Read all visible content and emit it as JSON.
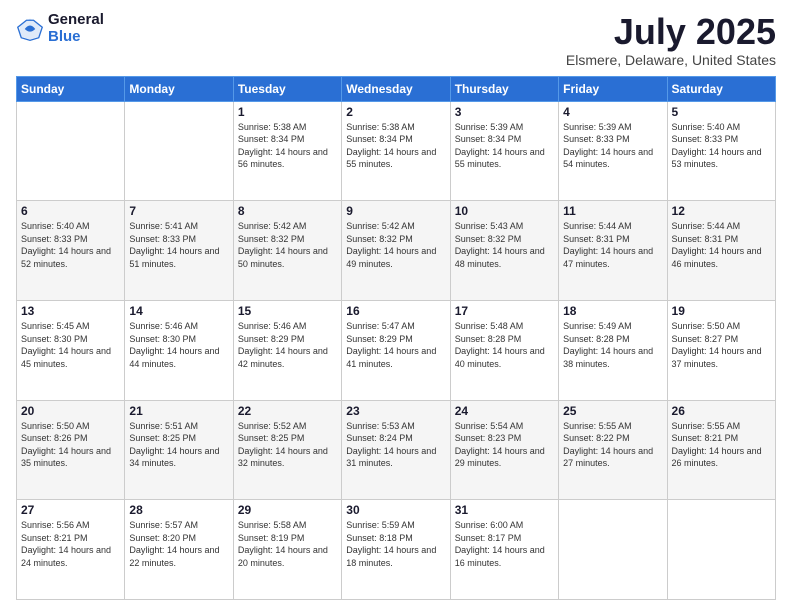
{
  "logo": {
    "general": "General",
    "blue": "Blue"
  },
  "title": "July 2025",
  "subtitle": "Elsmere, Delaware, United States",
  "days_of_week": [
    "Sunday",
    "Monday",
    "Tuesday",
    "Wednesday",
    "Thursday",
    "Friday",
    "Saturday"
  ],
  "weeks": [
    [
      {
        "day": "",
        "sunrise": "",
        "sunset": "",
        "daylight": ""
      },
      {
        "day": "",
        "sunrise": "",
        "sunset": "",
        "daylight": ""
      },
      {
        "day": "1",
        "sunrise": "Sunrise: 5:38 AM",
        "sunset": "Sunset: 8:34 PM",
        "daylight": "Daylight: 14 hours and 56 minutes."
      },
      {
        "day": "2",
        "sunrise": "Sunrise: 5:38 AM",
        "sunset": "Sunset: 8:34 PM",
        "daylight": "Daylight: 14 hours and 55 minutes."
      },
      {
        "day": "3",
        "sunrise": "Sunrise: 5:39 AM",
        "sunset": "Sunset: 8:34 PM",
        "daylight": "Daylight: 14 hours and 55 minutes."
      },
      {
        "day": "4",
        "sunrise": "Sunrise: 5:39 AM",
        "sunset": "Sunset: 8:33 PM",
        "daylight": "Daylight: 14 hours and 54 minutes."
      },
      {
        "day": "5",
        "sunrise": "Sunrise: 5:40 AM",
        "sunset": "Sunset: 8:33 PM",
        "daylight": "Daylight: 14 hours and 53 minutes."
      }
    ],
    [
      {
        "day": "6",
        "sunrise": "Sunrise: 5:40 AM",
        "sunset": "Sunset: 8:33 PM",
        "daylight": "Daylight: 14 hours and 52 minutes."
      },
      {
        "day": "7",
        "sunrise": "Sunrise: 5:41 AM",
        "sunset": "Sunset: 8:33 PM",
        "daylight": "Daylight: 14 hours and 51 minutes."
      },
      {
        "day": "8",
        "sunrise": "Sunrise: 5:42 AM",
        "sunset": "Sunset: 8:32 PM",
        "daylight": "Daylight: 14 hours and 50 minutes."
      },
      {
        "day": "9",
        "sunrise": "Sunrise: 5:42 AM",
        "sunset": "Sunset: 8:32 PM",
        "daylight": "Daylight: 14 hours and 49 minutes."
      },
      {
        "day": "10",
        "sunrise": "Sunrise: 5:43 AM",
        "sunset": "Sunset: 8:32 PM",
        "daylight": "Daylight: 14 hours and 48 minutes."
      },
      {
        "day": "11",
        "sunrise": "Sunrise: 5:44 AM",
        "sunset": "Sunset: 8:31 PM",
        "daylight": "Daylight: 14 hours and 47 minutes."
      },
      {
        "day": "12",
        "sunrise": "Sunrise: 5:44 AM",
        "sunset": "Sunset: 8:31 PM",
        "daylight": "Daylight: 14 hours and 46 minutes."
      }
    ],
    [
      {
        "day": "13",
        "sunrise": "Sunrise: 5:45 AM",
        "sunset": "Sunset: 8:30 PM",
        "daylight": "Daylight: 14 hours and 45 minutes."
      },
      {
        "day": "14",
        "sunrise": "Sunrise: 5:46 AM",
        "sunset": "Sunset: 8:30 PM",
        "daylight": "Daylight: 14 hours and 44 minutes."
      },
      {
        "day": "15",
        "sunrise": "Sunrise: 5:46 AM",
        "sunset": "Sunset: 8:29 PM",
        "daylight": "Daylight: 14 hours and 42 minutes."
      },
      {
        "day": "16",
        "sunrise": "Sunrise: 5:47 AM",
        "sunset": "Sunset: 8:29 PM",
        "daylight": "Daylight: 14 hours and 41 minutes."
      },
      {
        "day": "17",
        "sunrise": "Sunrise: 5:48 AM",
        "sunset": "Sunset: 8:28 PM",
        "daylight": "Daylight: 14 hours and 40 minutes."
      },
      {
        "day": "18",
        "sunrise": "Sunrise: 5:49 AM",
        "sunset": "Sunset: 8:28 PM",
        "daylight": "Daylight: 14 hours and 38 minutes."
      },
      {
        "day": "19",
        "sunrise": "Sunrise: 5:50 AM",
        "sunset": "Sunset: 8:27 PM",
        "daylight": "Daylight: 14 hours and 37 minutes."
      }
    ],
    [
      {
        "day": "20",
        "sunrise": "Sunrise: 5:50 AM",
        "sunset": "Sunset: 8:26 PM",
        "daylight": "Daylight: 14 hours and 35 minutes."
      },
      {
        "day": "21",
        "sunrise": "Sunrise: 5:51 AM",
        "sunset": "Sunset: 8:25 PM",
        "daylight": "Daylight: 14 hours and 34 minutes."
      },
      {
        "day": "22",
        "sunrise": "Sunrise: 5:52 AM",
        "sunset": "Sunset: 8:25 PM",
        "daylight": "Daylight: 14 hours and 32 minutes."
      },
      {
        "day": "23",
        "sunrise": "Sunrise: 5:53 AM",
        "sunset": "Sunset: 8:24 PM",
        "daylight": "Daylight: 14 hours and 31 minutes."
      },
      {
        "day": "24",
        "sunrise": "Sunrise: 5:54 AM",
        "sunset": "Sunset: 8:23 PM",
        "daylight": "Daylight: 14 hours and 29 minutes."
      },
      {
        "day": "25",
        "sunrise": "Sunrise: 5:55 AM",
        "sunset": "Sunset: 8:22 PM",
        "daylight": "Daylight: 14 hours and 27 minutes."
      },
      {
        "day": "26",
        "sunrise": "Sunrise: 5:55 AM",
        "sunset": "Sunset: 8:21 PM",
        "daylight": "Daylight: 14 hours and 26 minutes."
      }
    ],
    [
      {
        "day": "27",
        "sunrise": "Sunrise: 5:56 AM",
        "sunset": "Sunset: 8:21 PM",
        "daylight": "Daylight: 14 hours and 24 minutes."
      },
      {
        "day": "28",
        "sunrise": "Sunrise: 5:57 AM",
        "sunset": "Sunset: 8:20 PM",
        "daylight": "Daylight: 14 hours and 22 minutes."
      },
      {
        "day": "29",
        "sunrise": "Sunrise: 5:58 AM",
        "sunset": "Sunset: 8:19 PM",
        "daylight": "Daylight: 14 hours and 20 minutes."
      },
      {
        "day": "30",
        "sunrise": "Sunrise: 5:59 AM",
        "sunset": "Sunset: 8:18 PM",
        "daylight": "Daylight: 14 hours and 18 minutes."
      },
      {
        "day": "31",
        "sunrise": "Sunrise: 6:00 AM",
        "sunset": "Sunset: 8:17 PM",
        "daylight": "Daylight: 14 hours and 16 minutes."
      },
      {
        "day": "",
        "sunrise": "",
        "sunset": "",
        "daylight": ""
      },
      {
        "day": "",
        "sunrise": "",
        "sunset": "",
        "daylight": ""
      }
    ]
  ]
}
